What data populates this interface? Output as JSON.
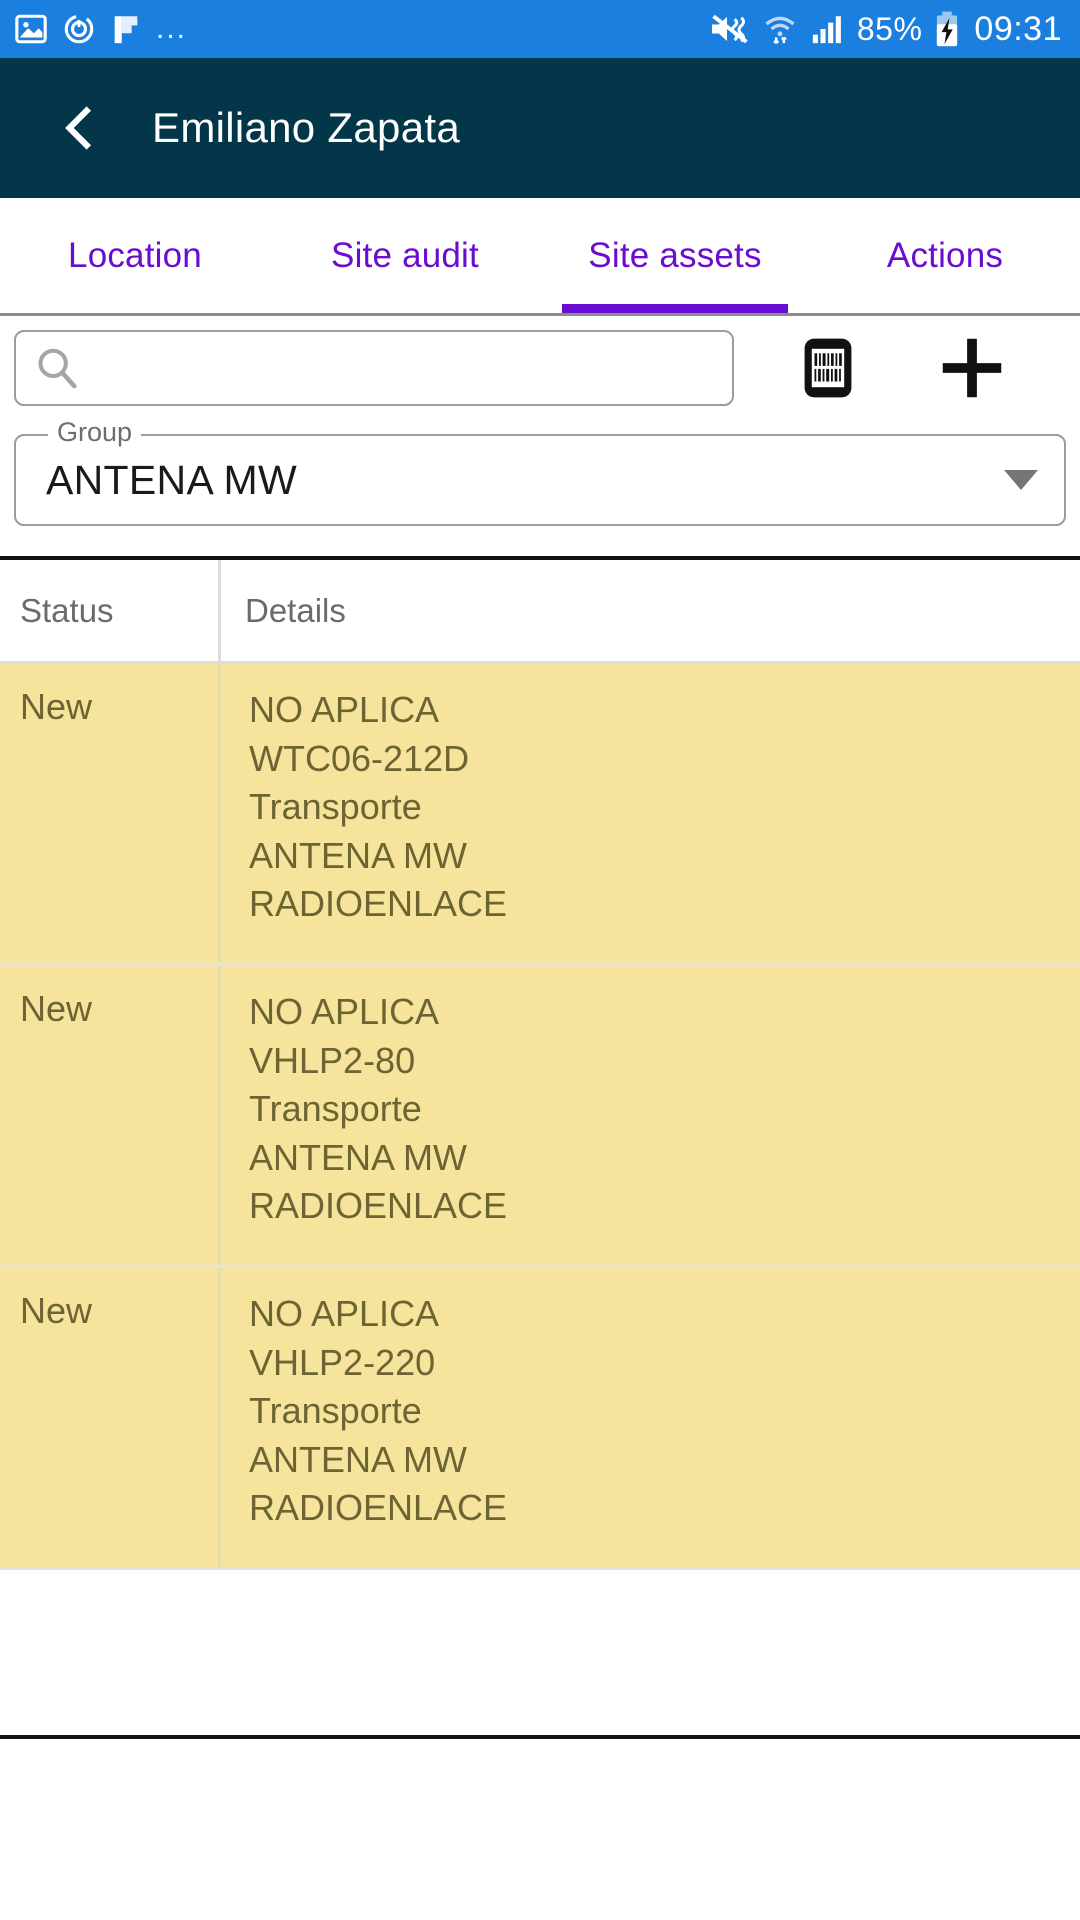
{
  "status_bar": {
    "icons_left": [
      "image-icon",
      "timer-icon",
      "flag-icon",
      "overflow-dots-icon"
    ],
    "overflow": "...",
    "icons_right": [
      "mute-icon",
      "wifi-icon",
      "signal-icon",
      "battery-charging-icon"
    ],
    "battery": "85%",
    "clock": "09:31"
  },
  "app_bar": {
    "back_icon": "back-chevron-icon",
    "title": "Emiliano Zapata"
  },
  "tabs": {
    "items": [
      {
        "label": "Location",
        "active": false
      },
      {
        "label": "Site audit",
        "active": false
      },
      {
        "label": "Site assets",
        "active": true
      },
      {
        "label": "Actions",
        "active": false
      }
    ],
    "active_index": 2,
    "accent_color": "#6a0dd0"
  },
  "toolbar": {
    "search": {
      "icon": "search-icon",
      "value": "",
      "placeholder": ""
    },
    "barcode_button": {
      "icon": "barcode-scanner-icon",
      "label": ""
    },
    "add_button": {
      "icon": "plus-icon",
      "label": ""
    }
  },
  "group_select": {
    "label": "Group",
    "value": "ANTENA MW",
    "caret_icon": "chevron-down-icon"
  },
  "assets_table": {
    "columns": [
      "Status",
      "Details"
    ],
    "row_highlight_color": "#f6e49c",
    "rows": [
      {
        "status": "New",
        "details_lines": [
          "NO APLICA",
          "WTC06-212D",
          "Transporte",
          "ANTENA MW",
          "RADIOENLACE"
        ]
      },
      {
        "status": "New",
        "details_lines": [
          "NO APLICA",
          "VHLP2-80",
          "Transporte",
          "ANTENA MW",
          "RADIOENLACE"
        ]
      },
      {
        "status": "New",
        "details_lines": [
          "NO APLICA",
          "VHLP2-220",
          "Transporte",
          "ANTENA MW",
          "RADIOENLACE"
        ]
      }
    ]
  }
}
